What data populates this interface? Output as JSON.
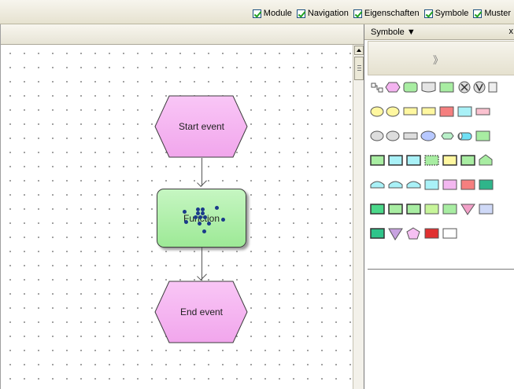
{
  "toolbar": {
    "toggles": [
      {
        "label": "Module",
        "checked": true
      },
      {
        "label": "Navigation",
        "checked": true
      },
      {
        "label": "Eigenschaften",
        "checked": true
      },
      {
        "label": "Symbole",
        "checked": true
      },
      {
        "label": "Muster",
        "checked": true
      }
    ]
  },
  "diagram": {
    "start_event": "Start event",
    "function": "Function",
    "end_event": "End event"
  },
  "panel": {
    "title": "Symbole",
    "dropdown_icon": "triangle-down-icon",
    "close_label": "x",
    "expand_label": "»"
  },
  "colors": {
    "event_fill": "#f4b3f0",
    "function_fill": "#a8edA2",
    "selection": "#1a3a8a"
  }
}
